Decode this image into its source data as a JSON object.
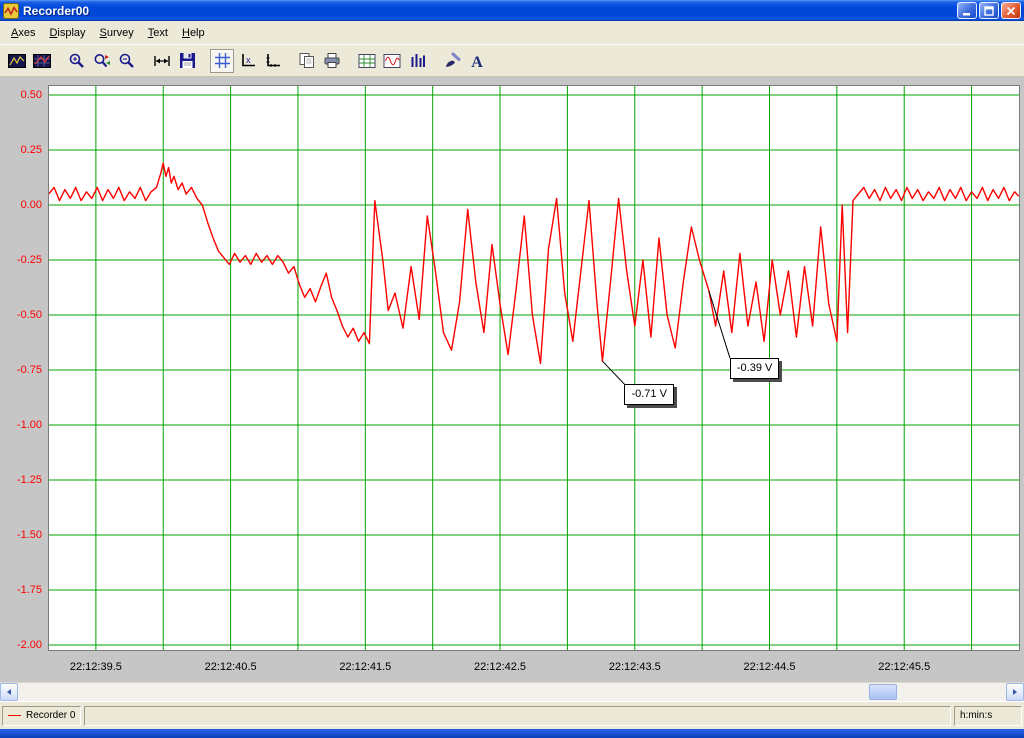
{
  "window": {
    "title": "Recorder00",
    "controls": [
      "minimize",
      "maximize",
      "close"
    ]
  },
  "menu": {
    "items": [
      {
        "label": "Axes"
      },
      {
        "label": "Display"
      },
      {
        "label": "Survey"
      },
      {
        "label": "Text"
      },
      {
        "label": "Help"
      }
    ]
  },
  "toolbar": {
    "buttons": [
      {
        "name": "plot-window"
      },
      {
        "name": "plot-window-alt"
      },
      {
        "name": "zoom"
      },
      {
        "name": "zoom-window"
      },
      {
        "name": "zoom-out"
      },
      {
        "name": "autoscale"
      },
      {
        "name": "save"
      },
      {
        "name": "grid",
        "active": true
      },
      {
        "name": "axis-scale"
      },
      {
        "name": "axis-ticks"
      },
      {
        "name": "copy"
      },
      {
        "name": "print"
      },
      {
        "name": "display-grid"
      },
      {
        "name": "display-wave"
      },
      {
        "name": "display-bars"
      },
      {
        "name": "brush"
      },
      {
        "name": "text"
      }
    ]
  },
  "statusbar": {
    "legend_label": "Recorder 0",
    "legend_color": "#ff0000",
    "unit_label": "h:min:s"
  },
  "chart_data": {
    "type": "line",
    "title": "",
    "x_axis": {
      "unit": "h:min:s",
      "t0_label": "22:12:39",
      "min": 0.152,
      "max": 7.352,
      "grid_start": 0.5,
      "grid_end": 7.0,
      "grid_step": 0.5
    },
    "y_axis": {
      "unit": "V",
      "min": -2.023,
      "max": 0.541
    },
    "grid_on": true,
    "grid_color": "#00a400",
    "y_tick_color": "#ff0000",
    "x_ticks": [
      {
        "t": 0.5,
        "label": "22:12:39.5"
      },
      {
        "t": 1.5,
        "label": "22:12:40.5"
      },
      {
        "t": 2.5,
        "label": "22:12:41.5"
      },
      {
        "t": 3.5,
        "label": "22:12:42.5"
      },
      {
        "t": 4.5,
        "label": "22:12:43.5"
      },
      {
        "t": 5.5,
        "label": "22:12:44.5"
      },
      {
        "t": 6.5,
        "label": "22:12:45.5"
      }
    ],
    "y_ticks": [
      {
        "v": 0.5,
        "label": "0.50"
      },
      {
        "v": 0.25,
        "label": "0.25"
      },
      {
        "v": 0.0,
        "label": "0.00"
      },
      {
        "v": -0.25,
        "label": "-0.25"
      },
      {
        "v": -0.5,
        "label": "-0.50"
      },
      {
        "v": -0.75,
        "label": "-0.75"
      },
      {
        "v": -1.0,
        "label": "-1.00"
      },
      {
        "v": -1.25,
        "label": "-1.25"
      },
      {
        "v": -1.5,
        "label": "-1.50"
      },
      {
        "v": -1.75,
        "label": "-1.75"
      },
      {
        "v": -2.0,
        "label": "-2.00"
      }
    ],
    "series": [
      {
        "name": "Recorder 0",
        "color": "#ff0000",
        "points": [
          [
            0.15,
            0.05
          ],
          [
            0.19,
            0.08
          ],
          [
            0.23,
            0.02
          ],
          [
            0.27,
            0.07
          ],
          [
            0.31,
            0.03
          ],
          [
            0.35,
            0.08
          ],
          [
            0.39,
            0.02
          ],
          [
            0.43,
            0.06
          ],
          [
            0.47,
            0.03
          ],
          [
            0.51,
            0.08
          ],
          [
            0.55,
            0.02
          ],
          [
            0.59,
            0.07
          ],
          [
            0.63,
            0.03
          ],
          [
            0.67,
            0.08
          ],
          [
            0.71,
            0.02
          ],
          [
            0.75,
            0.06
          ],
          [
            0.79,
            0.03
          ],
          [
            0.83,
            0.08
          ],
          [
            0.87,
            0.02
          ],
          [
            0.91,
            0.06
          ],
          [
            0.95,
            0.08
          ],
          [
            0.98,
            0.14
          ],
          [
            1.0,
            0.19
          ],
          [
            1.02,
            0.13
          ],
          [
            1.04,
            0.17
          ],
          [
            1.06,
            0.1
          ],
          [
            1.08,
            0.13
          ],
          [
            1.11,
            0.07
          ],
          [
            1.14,
            0.1
          ],
          [
            1.17,
            0.05
          ],
          [
            1.21,
            0.08
          ],
          [
            1.25,
            0.03
          ],
          [
            1.29,
            0.0
          ],
          [
            1.33,
            -0.08
          ],
          [
            1.37,
            -0.15
          ],
          [
            1.41,
            -0.21
          ],
          [
            1.45,
            -0.24
          ],
          [
            1.49,
            -0.27
          ],
          [
            1.53,
            -0.22
          ],
          [
            1.57,
            -0.26
          ],
          [
            1.61,
            -0.23
          ],
          [
            1.65,
            -0.27
          ],
          [
            1.69,
            -0.22
          ],
          [
            1.73,
            -0.26
          ],
          [
            1.77,
            -0.23
          ],
          [
            1.81,
            -0.27
          ],
          [
            1.85,
            -0.23
          ],
          [
            1.89,
            -0.26
          ],
          [
            1.93,
            -0.31
          ],
          [
            1.97,
            -0.28
          ],
          [
            2.01,
            -0.36
          ],
          [
            2.05,
            -0.42
          ],
          [
            2.09,
            -0.38
          ],
          [
            2.13,
            -0.44
          ],
          [
            2.17,
            -0.37
          ],
          [
            2.21,
            -0.31
          ],
          [
            2.25,
            -0.42
          ],
          [
            2.29,
            -0.48
          ],
          [
            2.33,
            -0.55
          ],
          [
            2.37,
            -0.6
          ],
          [
            2.41,
            -0.56
          ],
          [
            2.45,
            -0.62
          ],
          [
            2.49,
            -0.58
          ],
          [
            2.53,
            -0.63
          ],
          [
            2.57,
            0.02
          ],
          [
            2.63,
            -0.25
          ],
          [
            2.67,
            -0.48
          ],
          [
            2.72,
            -0.4
          ],
          [
            2.78,
            -0.56
          ],
          [
            2.84,
            -0.28
          ],
          [
            2.9,
            -0.52
          ],
          [
            2.96,
            -0.05
          ],
          [
            3.02,
            -0.3
          ],
          [
            3.08,
            -0.58
          ],
          [
            3.14,
            -0.66
          ],
          [
            3.2,
            -0.44
          ],
          [
            3.26,
            -0.02
          ],
          [
            3.32,
            -0.35
          ],
          [
            3.38,
            -0.58
          ],
          [
            3.44,
            -0.18
          ],
          [
            3.5,
            -0.45
          ],
          [
            3.56,
            -0.68
          ],
          [
            3.62,
            -0.38
          ],
          [
            3.68,
            -0.05
          ],
          [
            3.74,
            -0.5
          ],
          [
            3.8,
            -0.72
          ],
          [
            3.86,
            -0.2
          ],
          [
            3.92,
            0.03
          ],
          [
            3.98,
            -0.4
          ],
          [
            4.04,
            -0.62
          ],
          [
            4.1,
            -0.3
          ],
          [
            4.16,
            0.02
          ],
          [
            4.22,
            -0.45
          ],
          [
            4.26,
            -0.71
          ],
          [
            4.32,
            -0.35
          ],
          [
            4.38,
            0.03
          ],
          [
            4.44,
            -0.3
          ],
          [
            4.5,
            -0.55
          ],
          [
            4.56,
            -0.25
          ],
          [
            4.62,
            -0.6
          ],
          [
            4.68,
            -0.15
          ],
          [
            4.74,
            -0.5
          ],
          [
            4.8,
            -0.65
          ],
          [
            4.86,
            -0.35
          ],
          [
            4.92,
            -0.1
          ],
          [
            4.98,
            -0.25
          ],
          [
            5.05,
            -0.39
          ],
          [
            5.1,
            -0.55
          ],
          [
            5.16,
            -0.3
          ],
          [
            5.22,
            -0.58
          ],
          [
            5.28,
            -0.22
          ],
          [
            5.34,
            -0.55
          ],
          [
            5.4,
            -0.35
          ],
          [
            5.46,
            -0.62
          ],
          [
            5.52,
            -0.25
          ],
          [
            5.58,
            -0.5
          ],
          [
            5.64,
            -0.3
          ],
          [
            5.7,
            -0.6
          ],
          [
            5.76,
            -0.28
          ],
          [
            5.82,
            -0.55
          ],
          [
            5.88,
            -0.1
          ],
          [
            5.94,
            -0.45
          ],
          [
            6.0,
            -0.62
          ],
          [
            6.04,
            0.0
          ],
          [
            6.08,
            -0.58
          ],
          [
            6.12,
            0.02
          ],
          [
            6.16,
            0.05
          ],
          [
            6.2,
            0.08
          ],
          [
            6.24,
            0.03
          ],
          [
            6.28,
            0.07
          ],
          [
            6.32,
            0.02
          ],
          [
            6.36,
            0.08
          ],
          [
            6.4,
            0.03
          ],
          [
            6.44,
            0.07
          ],
          [
            6.48,
            0.02
          ],
          [
            6.52,
            0.08
          ],
          [
            6.56,
            0.03
          ],
          [
            6.6,
            0.07
          ],
          [
            6.64,
            0.02
          ],
          [
            6.68,
            0.06
          ],
          [
            6.72,
            0.03
          ],
          [
            6.76,
            0.08
          ],
          [
            6.8,
            0.02
          ],
          [
            6.84,
            0.07
          ],
          [
            6.88,
            0.03
          ],
          [
            6.92,
            0.08
          ],
          [
            6.96,
            0.02
          ],
          [
            7.0,
            0.06
          ],
          [
            7.04,
            0.03
          ],
          [
            7.08,
            0.08
          ],
          [
            7.12,
            0.02
          ],
          [
            7.16,
            0.07
          ],
          [
            7.2,
            0.03
          ],
          [
            7.24,
            0.08
          ],
          [
            7.28,
            0.02
          ],
          [
            7.32,
            0.06
          ],
          [
            7.35,
            0.04
          ]
        ]
      }
    ],
    "annotations": [
      {
        "label": "-0.71 V",
        "t": 4.26,
        "v": -0.71,
        "dx": 22,
        "dy": 23
      },
      {
        "label": "-0.39 V",
        "t": 5.05,
        "v": -0.39,
        "dx": 21,
        "dy": 67
      }
    ]
  }
}
